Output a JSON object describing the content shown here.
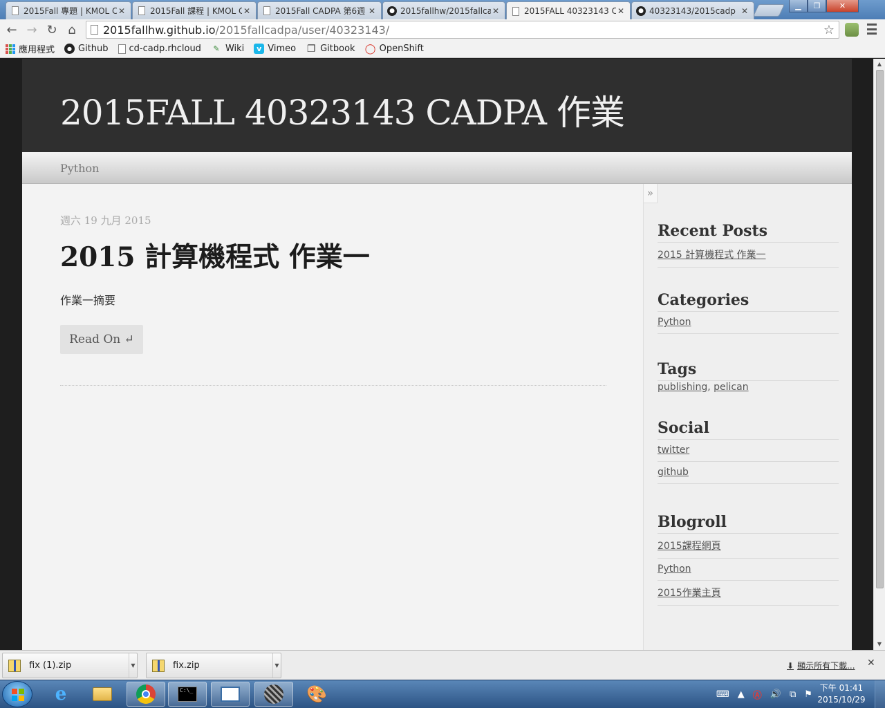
{
  "browser": {
    "tabs": [
      {
        "title": "2015Fall 專題 | KMOL C",
        "icon": "page-icon",
        "active": false
      },
      {
        "title": "2015Fall 課程 | KMOL C",
        "icon": "page-icon",
        "active": false
      },
      {
        "title": "2015Fall CADPA 第6週",
        "icon": "page-icon",
        "active": false
      },
      {
        "title": "2015fallhw/2015fallca",
        "icon": "github-icon",
        "active": false
      },
      {
        "title": "2015FALL 40323143 C",
        "icon": "page-icon",
        "active": true
      },
      {
        "title": "40323143/2015cadp",
        "icon": "github-icon",
        "active": false
      }
    ],
    "url_host": "2015fallhw.github.io",
    "url_path": "/2015fallcadpa/user/40323143/",
    "bookmarks": [
      {
        "label": "應用程式",
        "icon": "apps-grid-icon"
      },
      {
        "label": "Github",
        "icon": "github-icon"
      },
      {
        "label": "cd-cadp.rhcloud",
        "icon": "page-icon"
      },
      {
        "label": "Wiki",
        "icon": "wiki-icon"
      },
      {
        "label": "Vimeo",
        "icon": "vimeo-icon"
      },
      {
        "label": "Gitbook",
        "icon": "gitbook-icon"
      },
      {
        "label": "OpenShift",
        "icon": "openshift-icon"
      }
    ]
  },
  "site": {
    "title": "2015FALL 40323143 CADPA 作業",
    "nav": [
      "Python"
    ]
  },
  "post": {
    "date": "週六 19 九月 2015",
    "title": "2015 計算機程式 作業一",
    "summary": "作業一摘要",
    "read_on": "Read On ↵"
  },
  "sidebar": {
    "toggle": "»",
    "recent_posts": {
      "heading": "Recent Posts",
      "items": [
        "2015 計算機程式 作業一"
      ]
    },
    "categories": {
      "heading": "Categories",
      "items": [
        "Python"
      ]
    },
    "tags": {
      "heading": "Tags",
      "items": [
        "publishing",
        "pelican"
      ],
      "separator": ", "
    },
    "social": {
      "heading": "Social",
      "items": [
        "twitter",
        "github"
      ]
    },
    "blogroll": {
      "heading": "Blogroll",
      "items": [
        "2015課程網頁",
        "Python",
        "2015作業主頁"
      ]
    }
  },
  "downloads": {
    "items": [
      "fix (1).zip",
      "fix.zip"
    ],
    "show_all": "顯示所有下載...",
    "close": "✕"
  },
  "taskbar": {
    "clock_time": "下午 01:41",
    "clock_date": "2015/10/29"
  },
  "colors": {
    "header_bg": "#2f2f2f",
    "content_bg": "#f3f3f3",
    "sidebar_bg": "#efefef",
    "taskbar_bg": "#2c5384"
  }
}
